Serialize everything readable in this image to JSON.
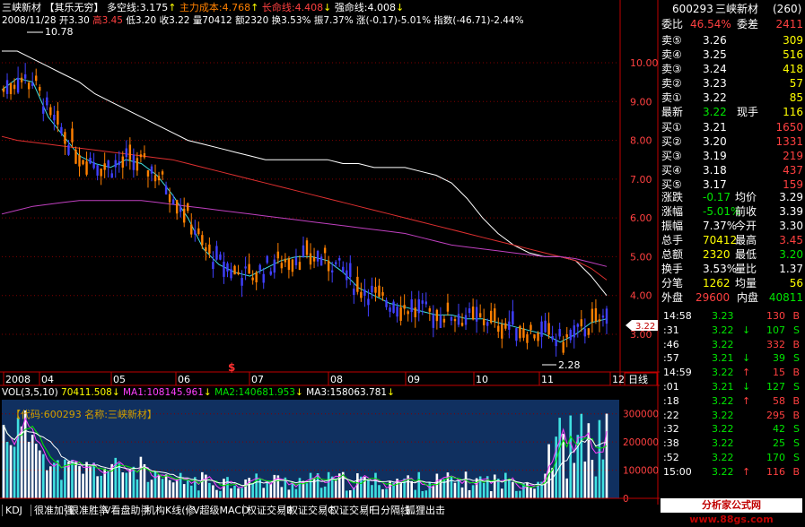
{
  "title": {
    "stock_name": "三峡新材",
    "indicator": "【其乐无穷】",
    "duokong_label": "多空线:",
    "duokong_value": "3.175",
    "zhuli_label": "主力成本:",
    "zhuli_value": "4.768",
    "changming_label": "长命线:",
    "changming_value": "4.408",
    "qiangming_label": "强命线:",
    "qiangming_value": "4.008"
  },
  "info": {
    "date": "2008/11/28",
    "open": "开3.30",
    "high": "高3.45",
    "low": "低3.20",
    "close": "收3.22",
    "vol": "量70412",
    "amt": "额2320",
    "turnover": "换3.53%",
    "amplitude": "振7.37%",
    "change": "涨(-0.17)-5.01%",
    "index": "指数(-46.71)-2.44%"
  },
  "price_axis": [
    "10.00",
    "9.00",
    "8.00",
    "7.00",
    "6.00",
    "5.00",
    "4.00",
    "3.00"
  ],
  "price_high_label": "10.78",
  "price_low_label": "2.28",
  "current_price_tag": "3.22",
  "date_axis": [
    "2008",
    "04",
    "05",
    "06",
    "07",
    "08",
    "09",
    "10",
    "11",
    "12"
  ],
  "chart_mode_label": "日线",
  "volume_legend": {
    "name": "VOL(3,5,10)",
    "vol": "70411.508",
    "ma1": "MA1:108145.961",
    "ma2": "MA2:140681.953",
    "ma3": "MA3:158063.781"
  },
  "volume_code_label": "【代码:600293  名称:三峡新材】",
  "volume_axis": [
    "300000",
    "200000",
    "100000",
    "0"
  ],
  "chart_data": {
    "type": "candlestick",
    "title": "三峡新材",
    "y_range": [
      2.0,
      11.0
    ],
    "series": [
      {
        "name": "多空线",
        "values": [
          9.3,
          9.6,
          9.5,
          8.6,
          8.1,
          7.6,
          7.4,
          7.3,
          7.5,
          7.4,
          7.1,
          6.6,
          6.0,
          5.2,
          4.8,
          4.6,
          4.5,
          4.7,
          4.9,
          5.0,
          5.0,
          4.9,
          4.6,
          4.2,
          4.0,
          3.8,
          3.7,
          3.6,
          3.5,
          3.5,
          3.4,
          3.4,
          3.3,
          3.2,
          3.1,
          3.0,
          2.8,
          3.0,
          3.3,
          3.4
        ]
      },
      {
        "name": "主力成本",
        "values": [
          10.3,
          10.3,
          10.1,
          9.9,
          9.7,
          9.5,
          9.2,
          9.0,
          8.8,
          8.6,
          8.4,
          8.2,
          8.0,
          7.9,
          7.8,
          7.7,
          7.6,
          7.5,
          7.5,
          7.5,
          7.5,
          7.5,
          7.4,
          7.4,
          7.3,
          7.3,
          7.3,
          7.2,
          7.1,
          6.9,
          6.5,
          6.0,
          5.6,
          5.3,
          5.1,
          5.0,
          5.0,
          4.9,
          4.5,
          4.0
        ]
      },
      {
        "name": "长命线",
        "values": [
          8.1,
          8.0,
          7.95,
          7.9,
          7.85,
          7.8,
          7.75,
          7.7,
          7.65,
          7.6,
          7.55,
          7.5,
          7.4,
          7.3,
          7.2,
          7.1,
          7.0,
          6.9,
          6.8,
          6.7,
          6.6,
          6.5,
          6.4,
          6.3,
          6.2,
          6.1,
          6.0,
          5.9,
          5.8,
          5.7,
          5.6,
          5.5,
          5.4,
          5.3,
          5.2,
          5.1,
          5.0,
          4.9,
          4.7,
          4.4
        ]
      },
      {
        "name": "强命线",
        "values": [
          6.1,
          6.2,
          6.3,
          6.35,
          6.4,
          6.45,
          6.45,
          6.45,
          6.45,
          6.45,
          6.4,
          6.35,
          6.3,
          6.25,
          6.2,
          6.15,
          6.1,
          6.05,
          6.0,
          5.95,
          5.9,
          5.85,
          5.8,
          5.75,
          5.7,
          5.65,
          5.6,
          5.5,
          5.4,
          5.3,
          5.25,
          5.2,
          5.15,
          5.1,
          5.05,
          5.0,
          5.0,
          4.95,
          4.85,
          4.75
        ]
      }
    ],
    "last": {
      "open": 3.3,
      "high": 3.45,
      "low": 3.2,
      "close": 3.22
    }
  },
  "quote_panel": {
    "code": "600293",
    "name": "三峡新材",
    "number": "(260)",
    "weibi_label": "委比",
    "weibi_value": "46.54%",
    "weicha_label": "委差",
    "weicha_value": "2411",
    "sells": [
      {
        "label": "卖⑤",
        "price": "3.26",
        "vol": "309"
      },
      {
        "label": "卖④",
        "price": "3.25",
        "vol": "516"
      },
      {
        "label": "卖③",
        "price": "3.24",
        "vol": "418"
      },
      {
        "label": "卖②",
        "price": "3.23",
        "vol": "57"
      },
      {
        "label": "卖①",
        "price": "3.22",
        "vol": "85"
      }
    ],
    "latest_label": "最新",
    "latest_value": "3.22",
    "xianshou_label": "现手",
    "xianshou_value": "116",
    "buys": [
      {
        "label": "买①",
        "price": "3.21",
        "vol": "1650"
      },
      {
        "label": "买②",
        "price": "3.20",
        "vol": "1331"
      },
      {
        "label": "买③",
        "price": "3.19",
        "vol": "219"
      },
      {
        "label": "买④",
        "price": "3.18",
        "vol": "437"
      },
      {
        "label": "买⑤",
        "price": "3.17",
        "vol": "159"
      }
    ],
    "stats": [
      {
        "l1": "涨跌",
        "v1": "-0.17",
        "l2": "均价",
        "v2": "3.29"
      },
      {
        "l1": "涨幅",
        "v1": "-5.01%",
        "l2": "前收",
        "v2": "3.39"
      },
      {
        "l1": "振幅",
        "v1": "7.37%",
        "l2": "今开",
        "v2": "3.30"
      },
      {
        "l1": "总手",
        "v1": "70412",
        "l2": "最高",
        "v2": "3.45"
      },
      {
        "l1": "总额",
        "v1": "2320",
        "l2": "最低",
        "v2": "3.20"
      },
      {
        "l1": "换手",
        "v1": "3.53%",
        "l2": "量比",
        "v2": "1.37"
      },
      {
        "l1": "分笔",
        "v1": "1262",
        "l2": "均量",
        "v2": "56"
      }
    ],
    "waipan_label": "外盘",
    "waipan_value": "29600",
    "neipan_label": "内盘",
    "neipan_value": "40811"
  },
  "ticks": [
    {
      "time": "14:58",
      "price": "3.23",
      "arrow": "",
      "vol": "130",
      "side": "B"
    },
    {
      "time": ":31",
      "price": "3.22",
      "arrow": "↓",
      "vol": "107",
      "side": "S"
    },
    {
      "time": ":46",
      "price": "3.22",
      "arrow": "",
      "vol": "332",
      "side": "B"
    },
    {
      "time": ":57",
      "price": "3.21",
      "arrow": "↓",
      "vol": "39",
      "side": "S"
    },
    {
      "time": "14:59",
      "price": "3.22",
      "arrow": "↑",
      "vol": "15",
      "side": "B"
    },
    {
      "time": ":01",
      "price": "3.21",
      "arrow": "↓",
      "vol": "127",
      "side": "S"
    },
    {
      "time": ":18",
      "price": "3.22",
      "arrow": "↑",
      "vol": "58",
      "side": "B"
    },
    {
      "time": ":22",
      "price": "3.22",
      "arrow": "",
      "vol": "295",
      "side": "B"
    },
    {
      "time": ":32",
      "price": "3.22",
      "arrow": "",
      "vol": "42",
      "side": "S"
    },
    {
      "time": ":38",
      "price": "3.22",
      "arrow": "",
      "vol": "25",
      "side": "S"
    },
    {
      "time": ":52",
      "price": "3.22",
      "arrow": "",
      "vol": "170",
      "side": "S"
    },
    {
      "time": "15:00",
      "price": "3.22",
      "arrow": "↑",
      "vol": "116",
      "side": "B"
    }
  ],
  "bottom_tabs": [
    "KDJ",
    "很准加强",
    "很准胜率",
    "V看盘助手",
    "机构K线(修",
    "V超级MACD",
    "权证交易B",
    "权证交易C",
    "权证交易F",
    "日分隔线",
    "狐狸出击"
  ],
  "watermark": "分析家公式网 www.88gs.com",
  "colors": {
    "up": "#ff8000",
    "down": "#4040ff",
    "ma_white": "#ffffff",
    "ma_red": "#e03030",
    "ma_magenta": "#c040c0",
    "ma_cyan": "#40e0e0",
    "volume_bg": "#103060"
  }
}
